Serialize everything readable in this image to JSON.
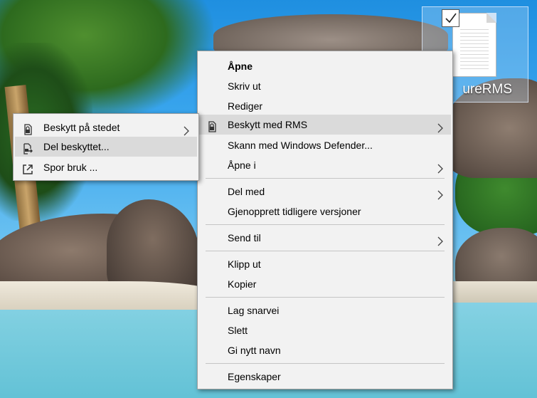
{
  "desktop": {
    "file": {
      "label": "ureRMS",
      "checked": true
    }
  },
  "main_menu": {
    "items": [
      {
        "label": "Åpne",
        "bold": true
      },
      {
        "label": "Skriv ut"
      },
      {
        "label": "Rediger"
      },
      {
        "label": "Beskytt med RMS",
        "icon": "lock-file-icon",
        "submenu": true,
        "highlighted": true
      },
      {
        "label": "Skann med Windows Defender..."
      },
      {
        "label": "Åpne i",
        "submenu": true
      },
      {
        "label": "Del med",
        "submenu": true
      },
      {
        "label": "Gjenopprett tidligere versjoner"
      },
      {
        "label": "Send til",
        "submenu": true
      },
      {
        "label": "Klipp ut"
      },
      {
        "label": "Kopier"
      },
      {
        "label": "Lag snarvei"
      },
      {
        "label": "Slett"
      },
      {
        "label": "Gi nytt navn"
      },
      {
        "label": "Egenskaper"
      }
    ]
  },
  "sub_menu": {
    "items": [
      {
        "label": "Beskytt på stedet",
        "icon": "lock-file-icon",
        "submenu": true
      },
      {
        "label": "Del beskyttet...",
        "icon": "share-protected-icon",
        "highlighted": true
      },
      {
        "label": "Spor bruk ...",
        "icon": "external-link-icon"
      }
    ]
  },
  "colors": {
    "menu_bg": "#f2f2f2",
    "highlight": "#dadada",
    "separator": "#c5c5c5"
  }
}
